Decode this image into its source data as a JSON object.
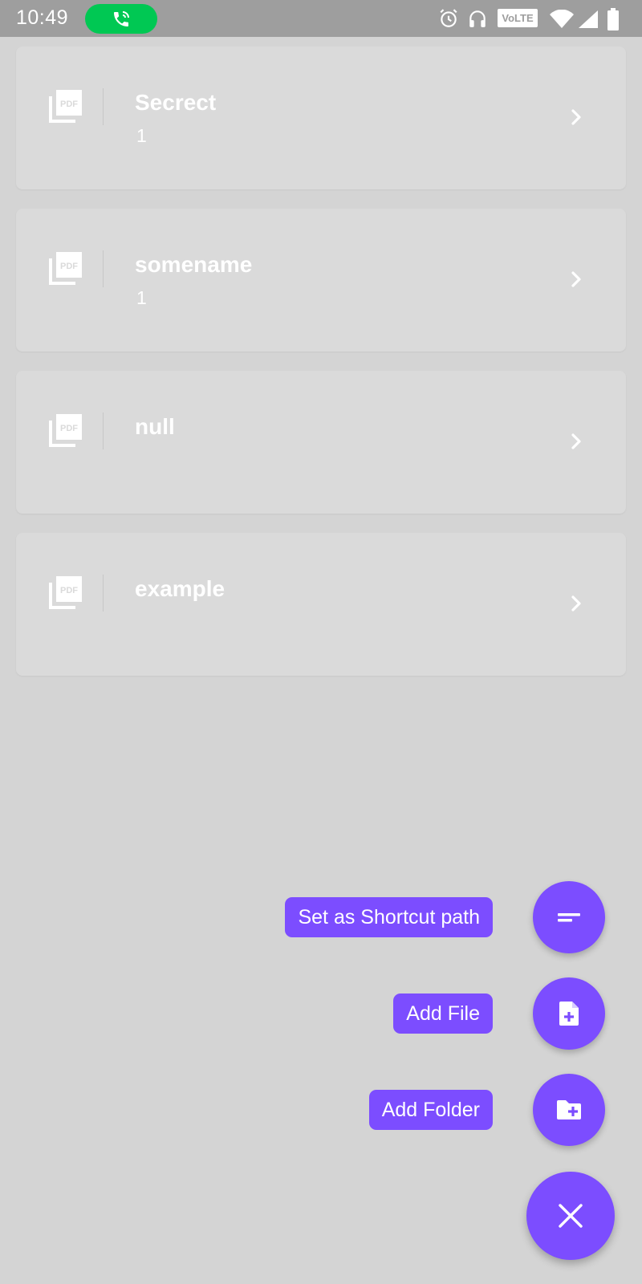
{
  "status_bar": {
    "time": "10:49",
    "call_indicator": "phone-call-icon",
    "icons": [
      "alarm-icon",
      "headphones-icon",
      "wifi-icon",
      "signal-icon",
      "battery-icon"
    ],
    "volte": "VoLTE"
  },
  "folders": [
    {
      "name": "Secrect",
      "count": "1",
      "icon": "pdf-stack-icon"
    },
    {
      "name": "somename",
      "count": "1",
      "icon": "pdf-stack-icon"
    },
    {
      "name": "null",
      "count": "",
      "icon": "pdf-stack-icon"
    },
    {
      "name": "example",
      "count": "",
      "icon": "pdf-stack-icon"
    }
  ],
  "speed_dial": {
    "shortcut_label": "Set as Shortcut path",
    "add_file_label": "Add File",
    "add_folder_label": "Add Folder",
    "close_icon": "close-icon"
  },
  "colors": {
    "accent": "#7c4dff",
    "call_green": "#00c853",
    "background": "#d4d4d4",
    "card": "#dadada"
  }
}
